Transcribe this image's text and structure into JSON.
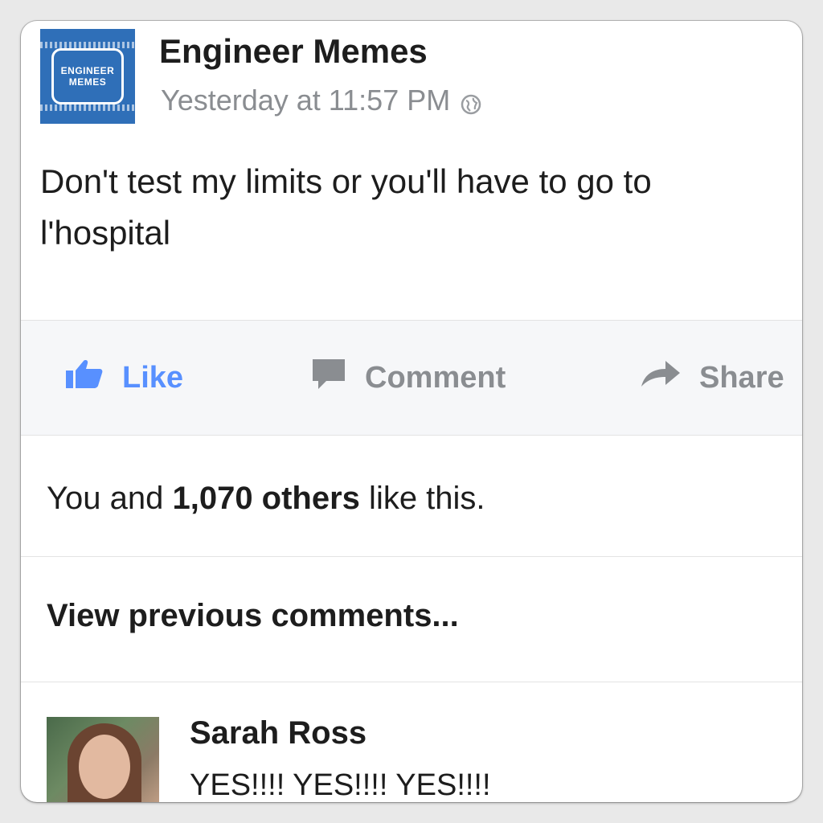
{
  "post": {
    "page_name": "Engineer Memes",
    "avatar_text_line1": "ENGINEER",
    "avatar_text_line2": "MEMES",
    "timestamp": "Yesterday at 11:57 PM",
    "text": "Don't test my limits or you'll have to go to l'hospital"
  },
  "actions": {
    "like_label": "Like",
    "comment_label": "Comment",
    "share_label": "Share"
  },
  "likes": {
    "prefix": "You and ",
    "count": "1,070 others",
    "suffix": " like this."
  },
  "comments": {
    "view_previous_label": "View previous comments...",
    "items": [
      {
        "author": "Sarah Ross",
        "text": "YES!!!! YES!!!! YES!!!!"
      }
    ]
  },
  "icons": {
    "privacy": "globe-icon",
    "like": "thumbs-up-icon",
    "comment": "speech-bubble-icon",
    "share": "share-arrow-icon"
  },
  "colors": {
    "brand_blue": "#5890ff",
    "page_avatar_blue": "#2f6fb8",
    "muted_gray": "#8a8d91"
  }
}
